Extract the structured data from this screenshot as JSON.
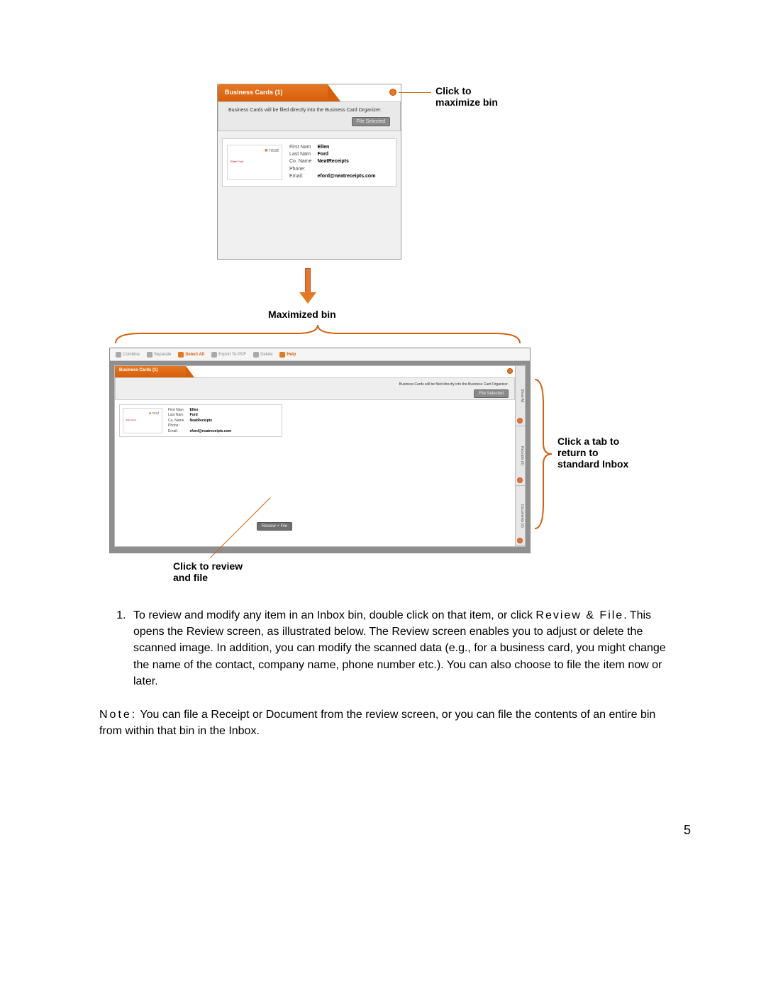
{
  "smallBin": {
    "headerTitle": "Business Cards (1)",
    "description": "Business Cards will be filed directly into the Business Card Organizer.",
    "fileSelectedBtn": "File Selected",
    "card": {
      "logo": "neat",
      "tinyText": "Ellen Ford",
      "fields": {
        "firstNameLabel": "First Nam",
        "firstName": "Ellen",
        "lastNameLabel": "Last Nam",
        "lastName": "Ford",
        "coNameLabel": "Co. Name",
        "coName": "NeatReceipts",
        "phoneLabel": "Phone:",
        "phone": "",
        "emailLabel": "Email:",
        "email": "eford@neatreceipts.com"
      }
    }
  },
  "callouts": {
    "maximize1": "Click to",
    "maximize2": "maximize bin",
    "midLabel": "Maximized bin",
    "sideTabs1": "Click a tab to",
    "sideTabs2": "return to",
    "sideTabs3": "standard Inbox",
    "review1": "Click to review",
    "review2": "and file"
  },
  "maxBin": {
    "toolbar": {
      "combine": "Combine",
      "separate": "Separate",
      "selectAll": "Select All",
      "exportToPdf": "Export To PDF",
      "delete": "Delete",
      "help": "Help"
    },
    "headerTitle": "Business Cards (1)",
    "description": "Business Cards will be filed directly into the Business Card Organizer.",
    "fileSelectedBtn": "File Selected",
    "reviewFileBtn": "Review + File",
    "sideTabs": {
      "showAll": "Show All",
      "receipts": "Receipts (0)",
      "documents": "Documents (0)"
    }
  },
  "bodyText": {
    "li1_part1": "To review and modify any item in an Inbox bin, double click on that item, or click ",
    "li1_reviewFile": "Review & File",
    "li1_part2": ". This opens the Review screen, as illustrated below. The Review screen enables you to adjust or delete the scanned image. In addition, you can modify the scanned data (e.g., for a business card, you might change the name of the contact, company name, phone number etc.). You can also choose to file the item now or later.",
    "noteLabel": "Note:",
    "noteText": " You can file a Receipt or Document from the review screen, or you can file the contents of an entire bin from within that bin in the Inbox."
  },
  "pageNumber": "5"
}
